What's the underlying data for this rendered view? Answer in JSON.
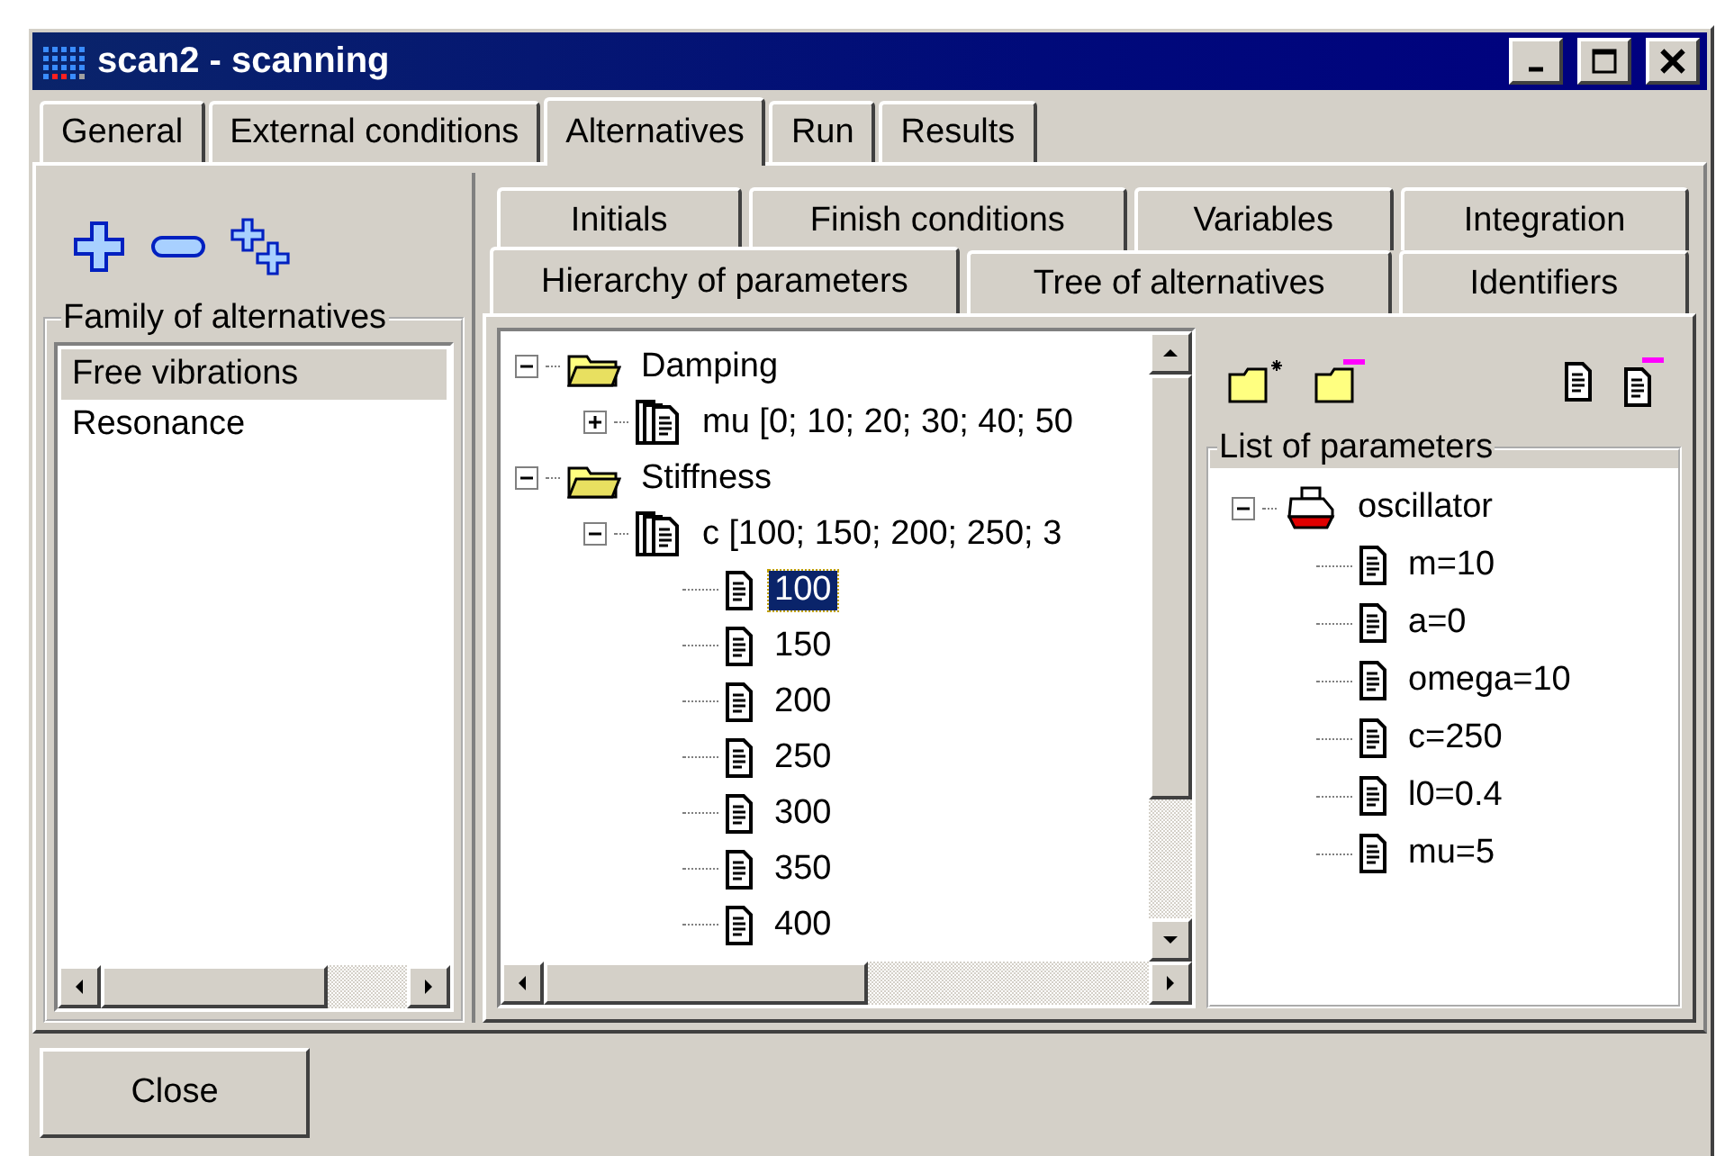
{
  "window": {
    "title": "scan2 - scanning"
  },
  "tabs": [
    {
      "label": "General",
      "selected": false
    },
    {
      "label": "External conditions",
      "selected": false
    },
    {
      "label": "Alternatives",
      "selected": true
    },
    {
      "label": "Run",
      "selected": false
    },
    {
      "label": "Results",
      "selected": false
    }
  ],
  "family": {
    "title": "Family of alternatives",
    "items": [
      {
        "label": "Free vibrations",
        "selected": true
      },
      {
        "label": "Resonance",
        "selected": false
      }
    ]
  },
  "subtabs": {
    "back_row": [
      {
        "label": "Initials",
        "selected": false
      },
      {
        "label": "Finish conditions",
        "selected": false
      },
      {
        "label": "Variables",
        "selected": false
      },
      {
        "label": "Integration",
        "selected": false
      }
    ],
    "front_row": [
      {
        "label": "Hierarchy of parameters",
        "selected": true
      },
      {
        "label": "Tree of alternatives",
        "selected": false
      },
      {
        "label": "Identifiers",
        "selected": false
      }
    ]
  },
  "hierarchy": [
    {
      "label": "Damping",
      "kind": "group",
      "expanded": true,
      "selected": false,
      "children": [
        {
          "label": "mu [0; 10; 20; 30; 40; 50",
          "kind": "parameter",
          "expanded": false,
          "selected": false
        }
      ]
    },
    {
      "label": "Stiffness",
      "kind": "group",
      "expanded": true,
      "selected": false,
      "children": [
        {
          "label": "c [100; 150; 200; 250; 3",
          "kind": "parameter",
          "expanded": true,
          "selected": false,
          "children": [
            {
              "label": "100",
              "kind": "value",
              "selected": true
            },
            {
              "label": "150",
              "kind": "value",
              "selected": false
            },
            {
              "label": "200",
              "kind": "value",
              "selected": false
            },
            {
              "label": "250",
              "kind": "value",
              "selected": false
            },
            {
              "label": "300",
              "kind": "value",
              "selected": false
            },
            {
              "label": "350",
              "kind": "value",
              "selected": false
            },
            {
              "label": "400",
              "kind": "value",
              "selected": false
            }
          ]
        }
      ]
    }
  ],
  "parameters": {
    "title": "List of parameters",
    "items": [
      {
        "label": "oscillator",
        "kind": "object",
        "expanded": true,
        "selected": false,
        "children": [
          {
            "label": "m=10",
            "kind": "value",
            "selected": false
          },
          {
            "label": "a=0",
            "kind": "value",
            "selected": false
          },
          {
            "label": "omega=10",
            "kind": "value",
            "selected": false
          },
          {
            "label": "c=250",
            "kind": "value",
            "selected": false
          },
          {
            "label": "l0=0.4",
            "kind": "value",
            "selected": false
          },
          {
            "label": "mu=5",
            "kind": "value",
            "selected": false
          }
        ]
      }
    ]
  },
  "close_button": {
    "label": "Close"
  }
}
